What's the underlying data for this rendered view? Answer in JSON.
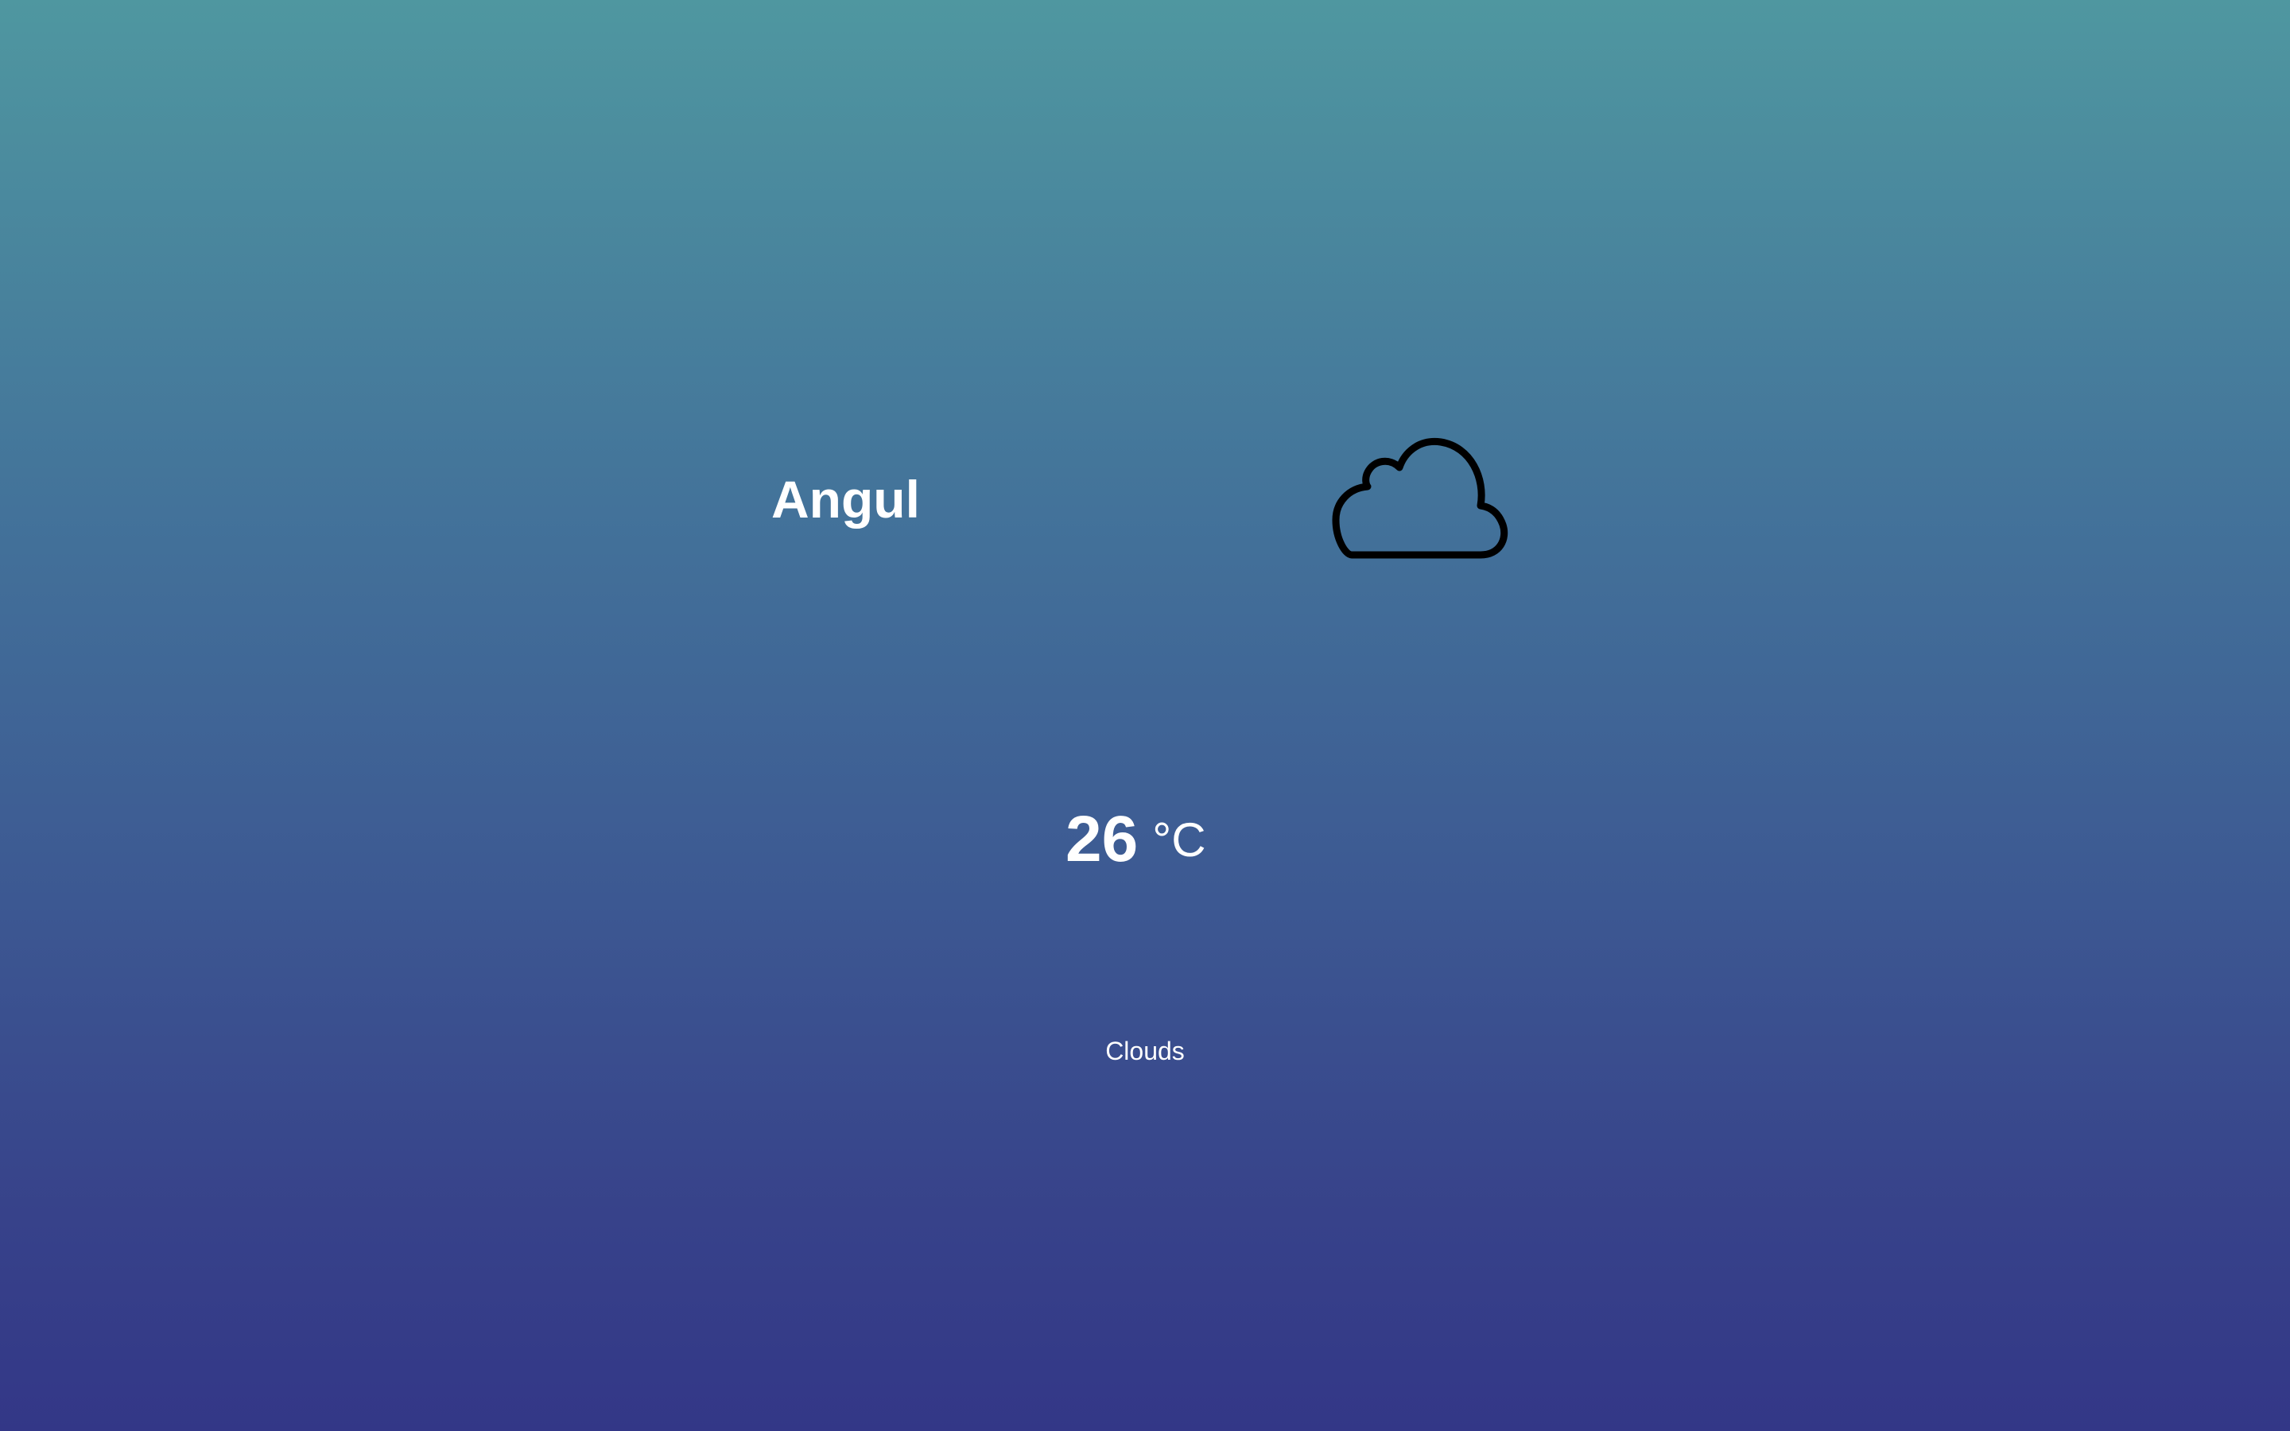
{
  "weather": {
    "city": "Angul",
    "temperature": "26",
    "unit": "°C",
    "condition": "Clouds",
    "icon": "cloud-icon"
  },
  "colors": {
    "background_top": "#4f97a0",
    "background_bottom": "#333787",
    "text": "#ffffff",
    "icon_stroke": "#000000"
  }
}
